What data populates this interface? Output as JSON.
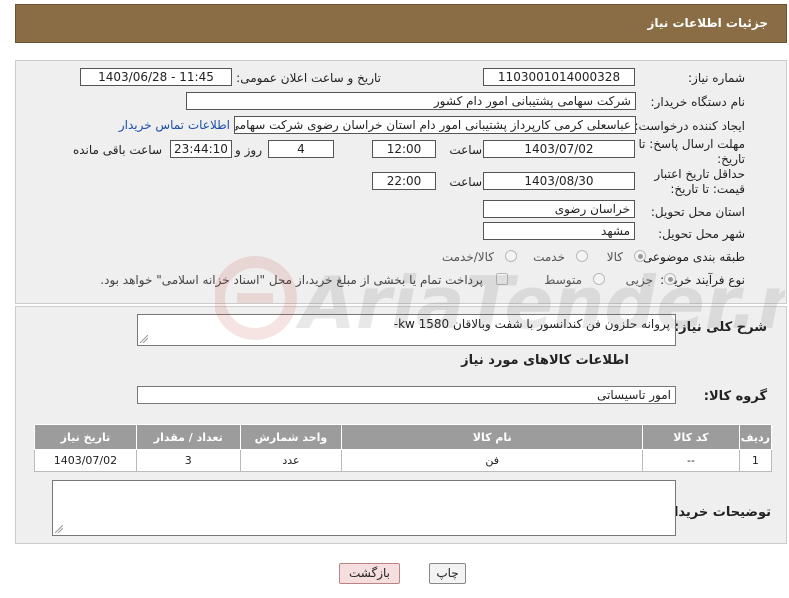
{
  "header": {
    "title": "جزئیات اطلاعات نیاز"
  },
  "form": {
    "need_number": {
      "label": "شماره نیاز:",
      "value": "1103001014000328"
    },
    "announce": {
      "label": "تاریخ و ساعت اعلان عمومی:",
      "value": "1403/06/28 - 11:45"
    },
    "buyer_org": {
      "label": "نام دستگاه خریدار:",
      "value": "شرکت سهامی پشتیبانی امور دام کشور"
    },
    "requester": {
      "label": "ایجاد کننده درخواست:",
      "value": "عباسعلی کرمی کارپرداز پشتیبانی امور دام استان خراسان رضوی شرکت سهامی",
      "contact_link": "اطلاعات تماس خریدار"
    },
    "deadline": {
      "label": "مهلت ارسال پاسخ: تا تاریخ:",
      "date": "1403/07/02",
      "time_label": "ساعت",
      "time": "12:00",
      "days": "4",
      "days_label": "روز و",
      "remaining": "23:44:10",
      "remaining_label": "ساعت باقی مانده"
    },
    "validity": {
      "label": "حداقل تاریخ اعتبار قیمت: تا تاریخ:",
      "date": "1403/08/30",
      "time_label": "ساعت",
      "time": "22:00"
    },
    "province": {
      "label": "استان محل تحویل:",
      "value": "خراسان رضوی"
    },
    "city": {
      "label": "شهر محل تحویل:",
      "value": "مشهد"
    },
    "category": {
      "label": "طبقه بندی موضوعی:",
      "options": [
        "کالا",
        "خدمت",
        "کالا/خدمت"
      ],
      "selected": "کالا"
    },
    "process": {
      "label": "نوع فرآیند خرید :",
      "options": [
        "جزیی",
        "متوسط"
      ],
      "selected": "جزیی",
      "note": "پرداخت تمام یا بخشی از مبلغ خرید،از محل \"اسناد خزانه اسلامی\" خواهد بود."
    }
  },
  "description": {
    "label": "شرح کلی نیاز:",
    "value": "پروانه حلزون فن کندانسور با شفت وبالاقان kw 1580-"
  },
  "goods": {
    "section_title": "اطلاعات کالاهای مورد نیاز",
    "group_label": "گروه کالا:",
    "group_value": "امور تاسیساتی",
    "columns": [
      "ردیف",
      "کد کالا",
      "نام کالا",
      "واحد شمارش",
      "تعداد / مقدار",
      "تاریخ نیاز"
    ],
    "rows": [
      [
        "1",
        "--",
        "فن",
        "عدد",
        "3",
        "1403/07/02"
      ]
    ]
  },
  "buyer_notes": {
    "label": "توضیحات خریدار:",
    "value": ""
  },
  "buttons": {
    "print": "چاپ",
    "back": "بازگشت"
  },
  "watermark": {
    "text": "AriaTender.neT"
  },
  "colors": {
    "header": "#8a6d44",
    "table_header": "#9c9c9c",
    "link": "#1a4fa8",
    "back_button": "#f6dede"
  }
}
